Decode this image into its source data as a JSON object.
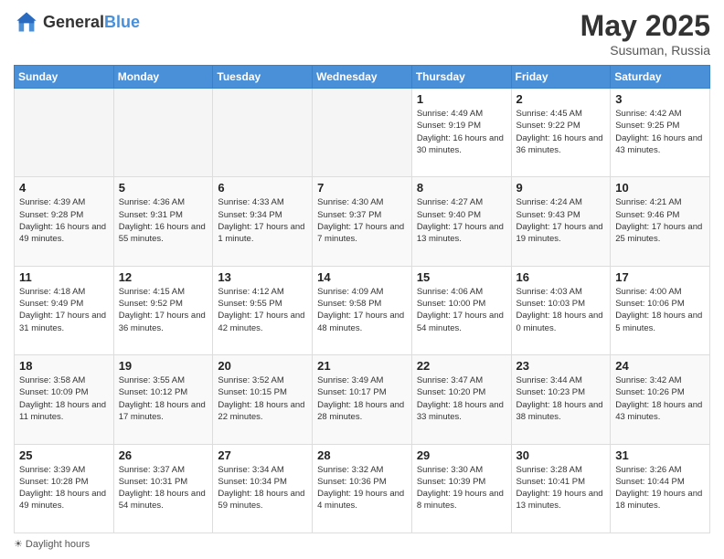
{
  "header": {
    "logo": {
      "general": "General",
      "blue": "Blue"
    },
    "title": "May 2025",
    "location": "Susuman, Russia"
  },
  "days_of_week": [
    "Sunday",
    "Monday",
    "Tuesday",
    "Wednesday",
    "Thursday",
    "Friday",
    "Saturday"
  ],
  "weeks": [
    [
      {
        "day": "",
        "sunrise": "",
        "sunset": "",
        "daylight": "",
        "empty": true
      },
      {
        "day": "",
        "sunrise": "",
        "sunset": "",
        "daylight": "",
        "empty": true
      },
      {
        "day": "",
        "sunrise": "",
        "sunset": "",
        "daylight": "",
        "empty": true
      },
      {
        "day": "",
        "sunrise": "",
        "sunset": "",
        "daylight": "",
        "empty": true
      },
      {
        "day": "1",
        "sunrise": "Sunrise: 4:49 AM",
        "sunset": "Sunset: 9:19 PM",
        "daylight": "Daylight: 16 hours and 30 minutes.",
        "empty": false
      },
      {
        "day": "2",
        "sunrise": "Sunrise: 4:45 AM",
        "sunset": "Sunset: 9:22 PM",
        "daylight": "Daylight: 16 hours and 36 minutes.",
        "empty": false
      },
      {
        "day": "3",
        "sunrise": "Sunrise: 4:42 AM",
        "sunset": "Sunset: 9:25 PM",
        "daylight": "Daylight: 16 hours and 43 minutes.",
        "empty": false
      }
    ],
    [
      {
        "day": "4",
        "sunrise": "Sunrise: 4:39 AM",
        "sunset": "Sunset: 9:28 PM",
        "daylight": "Daylight: 16 hours and 49 minutes.",
        "empty": false
      },
      {
        "day": "5",
        "sunrise": "Sunrise: 4:36 AM",
        "sunset": "Sunset: 9:31 PM",
        "daylight": "Daylight: 16 hours and 55 minutes.",
        "empty": false
      },
      {
        "day": "6",
        "sunrise": "Sunrise: 4:33 AM",
        "sunset": "Sunset: 9:34 PM",
        "daylight": "Daylight: 17 hours and 1 minute.",
        "empty": false
      },
      {
        "day": "7",
        "sunrise": "Sunrise: 4:30 AM",
        "sunset": "Sunset: 9:37 PM",
        "daylight": "Daylight: 17 hours and 7 minutes.",
        "empty": false
      },
      {
        "day": "8",
        "sunrise": "Sunrise: 4:27 AM",
        "sunset": "Sunset: 9:40 PM",
        "daylight": "Daylight: 17 hours and 13 minutes.",
        "empty": false
      },
      {
        "day": "9",
        "sunrise": "Sunrise: 4:24 AM",
        "sunset": "Sunset: 9:43 PM",
        "daylight": "Daylight: 17 hours and 19 minutes.",
        "empty": false
      },
      {
        "day": "10",
        "sunrise": "Sunrise: 4:21 AM",
        "sunset": "Sunset: 9:46 PM",
        "daylight": "Daylight: 17 hours and 25 minutes.",
        "empty": false
      }
    ],
    [
      {
        "day": "11",
        "sunrise": "Sunrise: 4:18 AM",
        "sunset": "Sunset: 9:49 PM",
        "daylight": "Daylight: 17 hours and 31 minutes.",
        "empty": false
      },
      {
        "day": "12",
        "sunrise": "Sunrise: 4:15 AM",
        "sunset": "Sunset: 9:52 PM",
        "daylight": "Daylight: 17 hours and 36 minutes.",
        "empty": false
      },
      {
        "day": "13",
        "sunrise": "Sunrise: 4:12 AM",
        "sunset": "Sunset: 9:55 PM",
        "daylight": "Daylight: 17 hours and 42 minutes.",
        "empty": false
      },
      {
        "day": "14",
        "sunrise": "Sunrise: 4:09 AM",
        "sunset": "Sunset: 9:58 PM",
        "daylight": "Daylight: 17 hours and 48 minutes.",
        "empty": false
      },
      {
        "day": "15",
        "sunrise": "Sunrise: 4:06 AM",
        "sunset": "Sunset: 10:00 PM",
        "daylight": "Daylight: 17 hours and 54 minutes.",
        "empty": false
      },
      {
        "day": "16",
        "sunrise": "Sunrise: 4:03 AM",
        "sunset": "Sunset: 10:03 PM",
        "daylight": "Daylight: 18 hours and 0 minutes.",
        "empty": false
      },
      {
        "day": "17",
        "sunrise": "Sunrise: 4:00 AM",
        "sunset": "Sunset: 10:06 PM",
        "daylight": "Daylight: 18 hours and 5 minutes.",
        "empty": false
      }
    ],
    [
      {
        "day": "18",
        "sunrise": "Sunrise: 3:58 AM",
        "sunset": "Sunset: 10:09 PM",
        "daylight": "Daylight: 18 hours and 11 minutes.",
        "empty": false
      },
      {
        "day": "19",
        "sunrise": "Sunrise: 3:55 AM",
        "sunset": "Sunset: 10:12 PM",
        "daylight": "Daylight: 18 hours and 17 minutes.",
        "empty": false
      },
      {
        "day": "20",
        "sunrise": "Sunrise: 3:52 AM",
        "sunset": "Sunset: 10:15 PM",
        "daylight": "Daylight: 18 hours and 22 minutes.",
        "empty": false
      },
      {
        "day": "21",
        "sunrise": "Sunrise: 3:49 AM",
        "sunset": "Sunset: 10:17 PM",
        "daylight": "Daylight: 18 hours and 28 minutes.",
        "empty": false
      },
      {
        "day": "22",
        "sunrise": "Sunrise: 3:47 AM",
        "sunset": "Sunset: 10:20 PM",
        "daylight": "Daylight: 18 hours and 33 minutes.",
        "empty": false
      },
      {
        "day": "23",
        "sunrise": "Sunrise: 3:44 AM",
        "sunset": "Sunset: 10:23 PM",
        "daylight": "Daylight: 18 hours and 38 minutes.",
        "empty": false
      },
      {
        "day": "24",
        "sunrise": "Sunrise: 3:42 AM",
        "sunset": "Sunset: 10:26 PM",
        "daylight": "Daylight: 18 hours and 43 minutes.",
        "empty": false
      }
    ],
    [
      {
        "day": "25",
        "sunrise": "Sunrise: 3:39 AM",
        "sunset": "Sunset: 10:28 PM",
        "daylight": "Daylight: 18 hours and 49 minutes.",
        "empty": false
      },
      {
        "day": "26",
        "sunrise": "Sunrise: 3:37 AM",
        "sunset": "Sunset: 10:31 PM",
        "daylight": "Daylight: 18 hours and 54 minutes.",
        "empty": false
      },
      {
        "day": "27",
        "sunrise": "Sunrise: 3:34 AM",
        "sunset": "Sunset: 10:34 PM",
        "daylight": "Daylight: 18 hours and 59 minutes.",
        "empty": false
      },
      {
        "day": "28",
        "sunrise": "Sunrise: 3:32 AM",
        "sunset": "Sunset: 10:36 PM",
        "daylight": "Daylight: 19 hours and 4 minutes.",
        "empty": false
      },
      {
        "day": "29",
        "sunrise": "Sunrise: 3:30 AM",
        "sunset": "Sunset: 10:39 PM",
        "daylight": "Daylight: 19 hours and 8 minutes.",
        "empty": false
      },
      {
        "day": "30",
        "sunrise": "Sunrise: 3:28 AM",
        "sunset": "Sunset: 10:41 PM",
        "daylight": "Daylight: 19 hours and 13 minutes.",
        "empty": false
      },
      {
        "day": "31",
        "sunrise": "Sunrise: 3:26 AM",
        "sunset": "Sunset: 10:44 PM",
        "daylight": "Daylight: 19 hours and 18 minutes.",
        "empty": false
      }
    ]
  ],
  "footer": {
    "daylight_hours": "Daylight hours"
  }
}
